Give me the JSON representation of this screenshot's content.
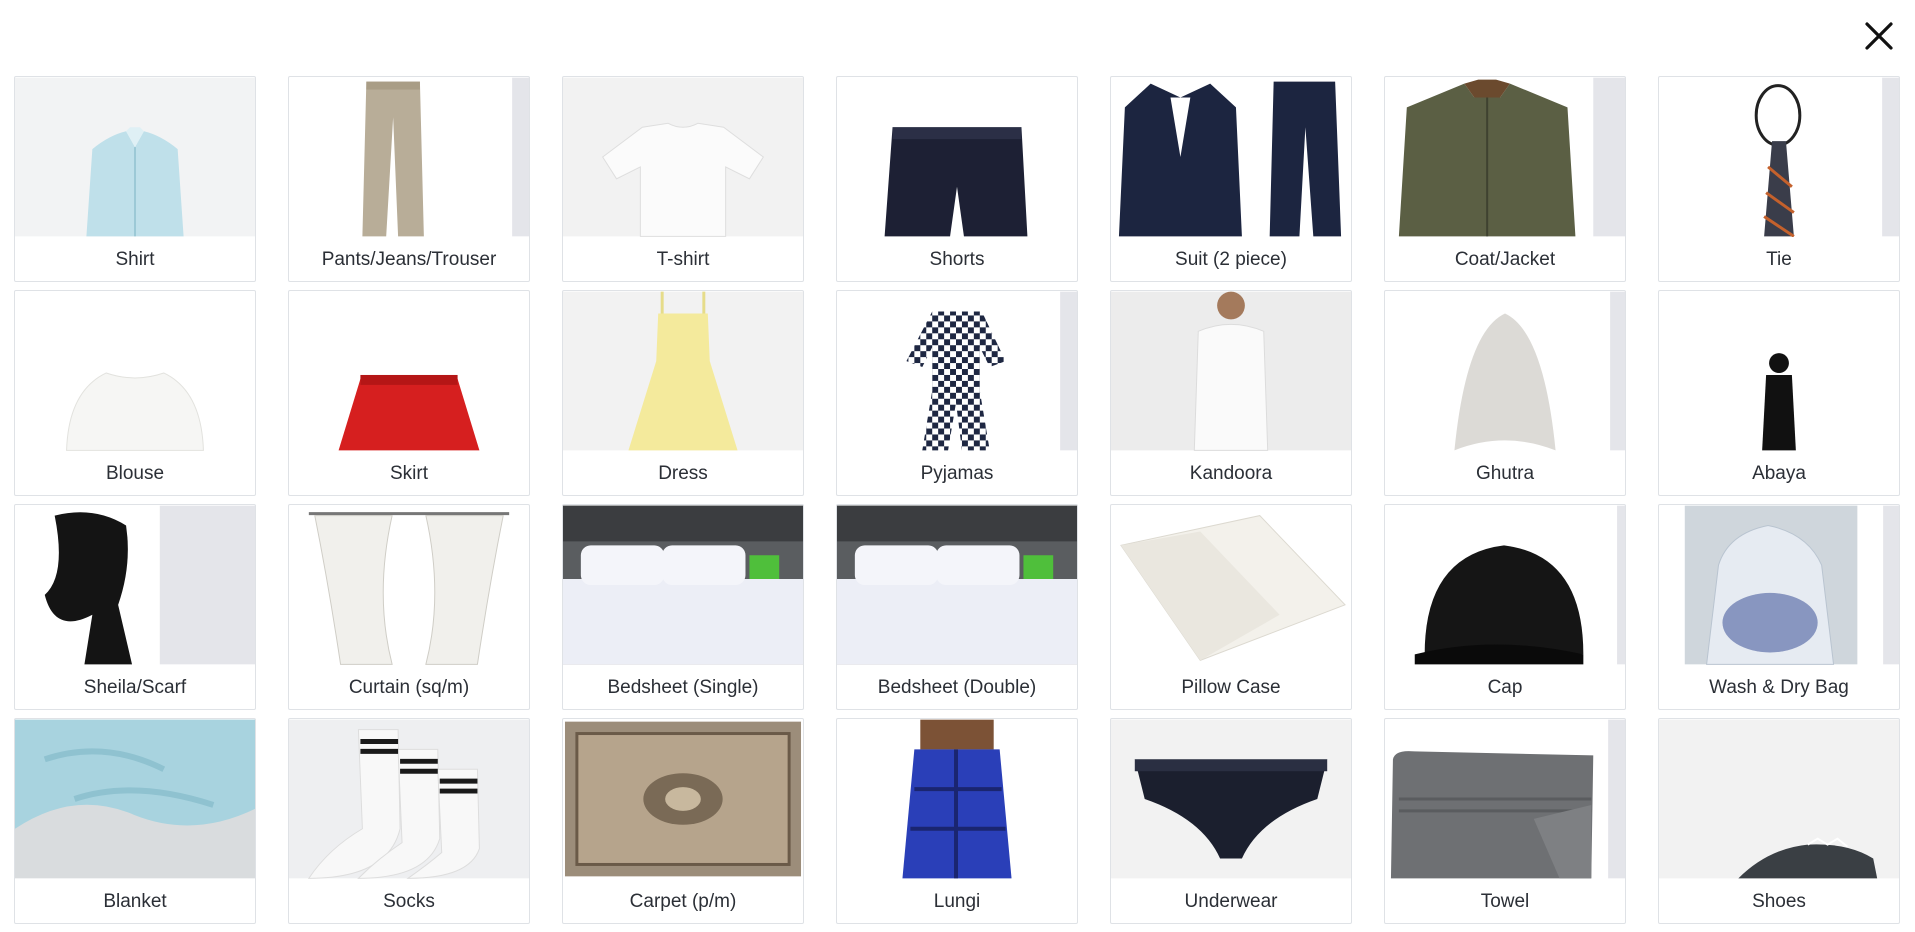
{
  "header": {
    "close_icon": "close-icon"
  },
  "items": [
    {
      "label": "Shirt",
      "icon": "shirt-icon"
    },
    {
      "label": "Pants/Jeans/Trouser",
      "icon": "pants-icon"
    },
    {
      "label": "T-shirt",
      "icon": "tshirt-icon"
    },
    {
      "label": "Shorts",
      "icon": "shorts-icon"
    },
    {
      "label": "Suit (2 piece)",
      "icon": "suit-icon"
    },
    {
      "label": "Coat/Jacket",
      "icon": "coat-icon"
    },
    {
      "label": "Tie",
      "icon": "tie-icon"
    },
    {
      "label": "Blouse",
      "icon": "blouse-icon"
    },
    {
      "label": "Skirt",
      "icon": "skirt-icon"
    },
    {
      "label": "Dress",
      "icon": "dress-icon"
    },
    {
      "label": "Pyjamas",
      "icon": "pyjamas-icon"
    },
    {
      "label": "Kandoora",
      "icon": "kandoora-icon"
    },
    {
      "label": "Ghutra",
      "icon": "ghutra-icon"
    },
    {
      "label": "Abaya",
      "icon": "abaya-icon"
    },
    {
      "label": "Sheila/Scarf",
      "icon": "scarf-icon"
    },
    {
      "label": "Curtain (sq/m)",
      "icon": "curtain-icon"
    },
    {
      "label": "Bedsheet (Single)",
      "icon": "bedsheet-icon"
    },
    {
      "label": "Bedsheet (Double)",
      "icon": "bedsheet-icon"
    },
    {
      "label": "Pillow Case",
      "icon": "pillow-icon"
    },
    {
      "label": "Cap",
      "icon": "cap-icon"
    },
    {
      "label": "Wash & Dry Bag",
      "icon": "laundry-bag-icon"
    },
    {
      "label": "Blanket",
      "icon": "blanket-icon"
    },
    {
      "label": "Socks",
      "icon": "socks-icon"
    },
    {
      "label": "Carpet (p/m)",
      "icon": "carpet-icon"
    },
    {
      "label": "Lungi",
      "icon": "lungi-icon"
    },
    {
      "label": "Underwear",
      "icon": "underwear-icon"
    },
    {
      "label": "Towel",
      "icon": "towel-icon"
    },
    {
      "label": "Shoes",
      "icon": "shoes-icon"
    }
  ]
}
